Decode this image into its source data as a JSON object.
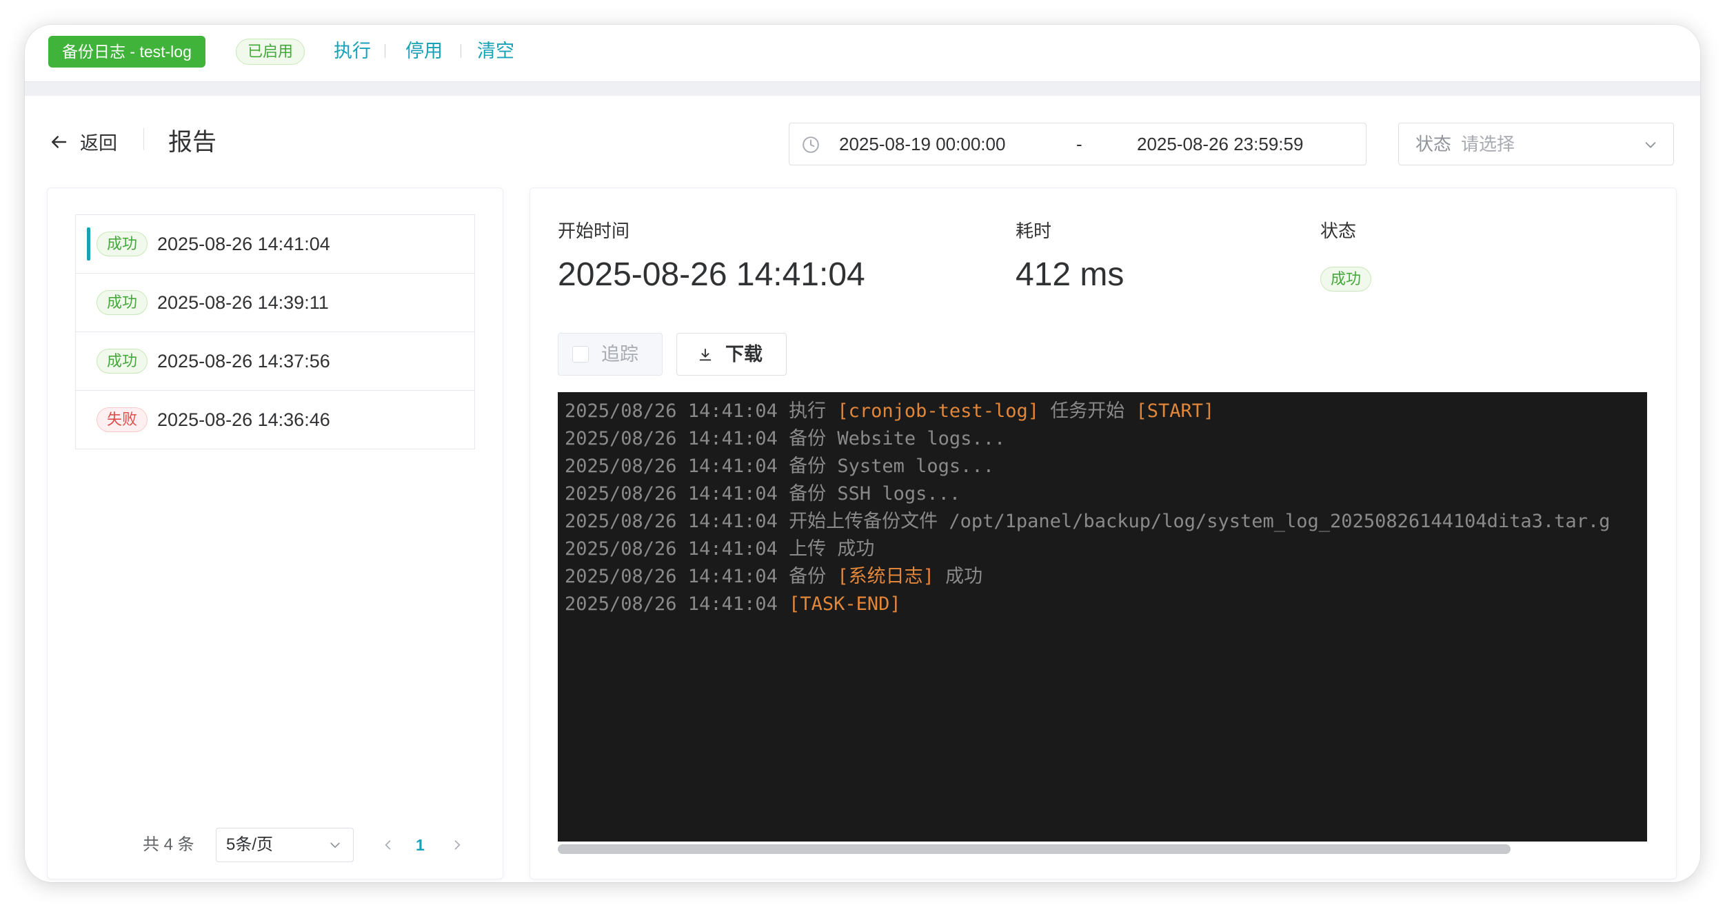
{
  "topbar": {
    "job_tag": "备份日志 - test-log",
    "status_tag": "已启用",
    "actions": {
      "run": "执行",
      "disable": "停用",
      "clear": "清空"
    }
  },
  "header": {
    "back_label": "返回",
    "title": "报告",
    "date_range": {
      "start": "2025-08-19 00:00:00",
      "separator": "-",
      "end": "2025-08-26 23:59:59"
    },
    "status_filter": {
      "label": "状态",
      "placeholder": "请选择"
    }
  },
  "records": [
    {
      "status": "成功",
      "status_type": "success",
      "time": "2025-08-26 14:41:04",
      "active": true
    },
    {
      "status": "成功",
      "status_type": "success",
      "time": "2025-08-26 14:39:11",
      "active": false
    },
    {
      "status": "成功",
      "status_type": "success",
      "time": "2025-08-26 14:37:56",
      "active": false
    },
    {
      "status": "失败",
      "status_type": "fail",
      "time": "2025-08-26 14:36:46",
      "active": false
    }
  ],
  "pagination": {
    "total_text": "共 4 条",
    "page_size": "5条/页",
    "current_page": "1"
  },
  "detail": {
    "start_time_label": "开始时间",
    "start_time": "2025-08-26 14:41:04",
    "duration_label": "耗时",
    "duration": "412 ms",
    "status_label": "状态",
    "status": "成功",
    "trace_label": "追踪",
    "download_label": "下载"
  },
  "log": [
    {
      "ts": "2025/08/26 14:41:04",
      "parts": [
        {
          "t": " 执行 ",
          "hl": false
        },
        {
          "t": "[cronjob-test-log]",
          "hl": true
        },
        {
          "t": " 任务开始 ",
          "hl": false
        },
        {
          "t": "[START]",
          "hl": true
        }
      ]
    },
    {
      "ts": "2025/08/26 14:41:04",
      "parts": [
        {
          "t": " 备份 Website logs...",
          "hl": false
        }
      ]
    },
    {
      "ts": "2025/08/26 14:41:04",
      "parts": [
        {
          "t": " 备份 System logs...",
          "hl": false
        }
      ]
    },
    {
      "ts": "2025/08/26 14:41:04",
      "parts": [
        {
          "t": " 备份 SSH logs...",
          "hl": false
        }
      ]
    },
    {
      "ts": "2025/08/26 14:41:04",
      "parts": [
        {
          "t": " 开始上传备份文件 /opt/1panel/backup/log/system_log_20250826144104dita3.tar.g",
          "hl": false
        }
      ]
    },
    {
      "ts": "2025/08/26 14:41:04",
      "parts": [
        {
          "t": " 上传 成功",
          "hl": false
        }
      ]
    },
    {
      "ts": "2025/08/26 14:41:04",
      "parts": [
        {
          "t": " 备份 ",
          "hl": false
        },
        {
          "t": "[系统日志]",
          "hl": true
        },
        {
          "t": " 成功",
          "hl": false
        }
      ]
    },
    {
      "ts": "2025/08/26 14:41:04",
      "parts": [
        {
          "t": " ",
          "hl": false
        },
        {
          "t": "[TASK-END]",
          "hl": true
        }
      ]
    }
  ],
  "colors": {
    "accent": "#17a2b8",
    "success_green": "#3fb33a",
    "fail_red": "#e14b4b",
    "log_background": "#1a1a1a",
    "log_highlight": "#e2863a"
  },
  "icons": [
    "arrow-left-icon",
    "clock-icon",
    "chevron-down-icon",
    "checkbox-icon",
    "download-icon",
    "chevron-left-icon",
    "chevron-right-icon"
  ]
}
